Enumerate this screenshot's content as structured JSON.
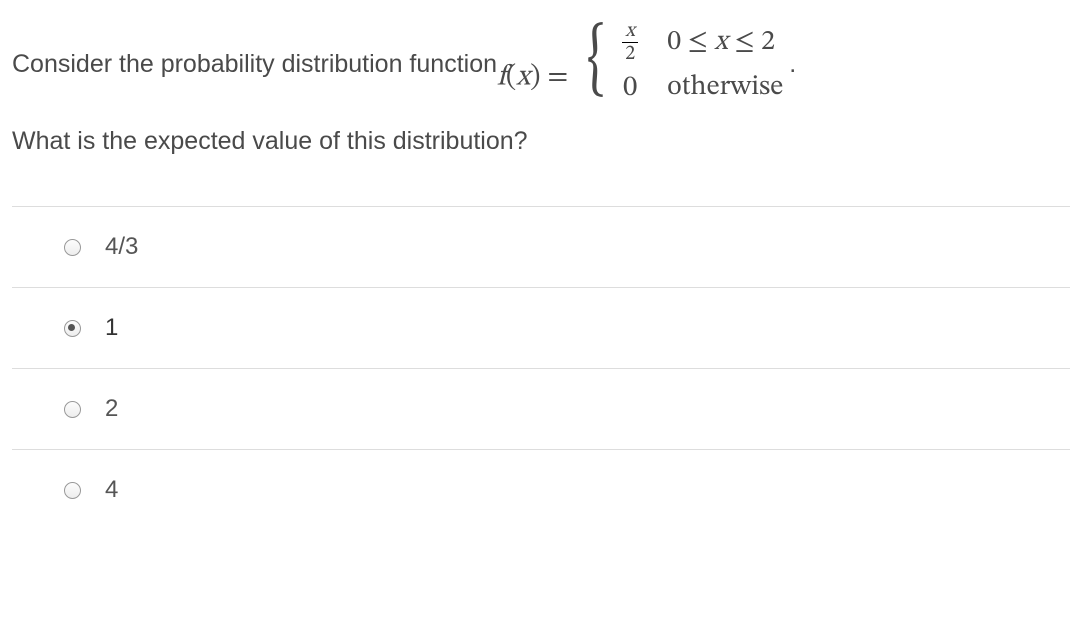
{
  "question": {
    "intro": "Consider the probability distribution function ",
    "func_lhs_f": "f",
    "func_lhs_x": "x",
    "eq": " = ",
    "case1_num": "x",
    "case1_den": "2",
    "case1_cond": "0 ≤ x ≤ 2",
    "case2_val": "0",
    "case2_cond": "otherwise",
    "period": ".",
    "followup": "What is the expected value of this distribution?"
  },
  "options": [
    {
      "label": "4/3",
      "selected": false
    },
    {
      "label": "1",
      "selected": true
    },
    {
      "label": "2",
      "selected": false
    },
    {
      "label": "4",
      "selected": false
    }
  ]
}
